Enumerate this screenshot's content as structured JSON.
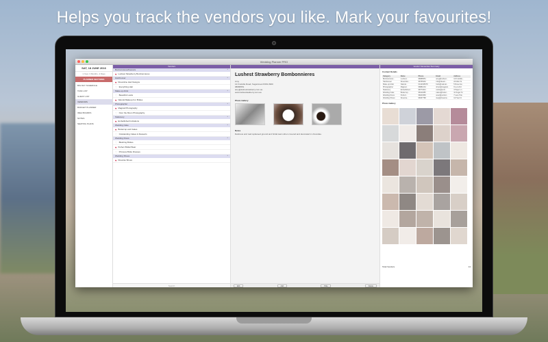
{
  "headline": "Helps you track the vendors you like. Mark your favourites!",
  "window": {
    "title": "Wedding Planner PRO"
  },
  "sidebar": {
    "date": "SAT, 18 JUNE 2016",
    "countdown": "1 Year, 3 Months, 4 Days",
    "section_label": "PLANNER SECTIONS",
    "items": [
      {
        "label": "BIG DAY SCHEDULE"
      },
      {
        "label": "TASK LIST"
      },
      {
        "label": "GUEST LIST"
      },
      {
        "label": "VENDORS"
      },
      {
        "label": "BUDGET PLANNER"
      },
      {
        "label": "IDEA BOARDS"
      },
      {
        "label": "NOTES"
      },
      {
        "label": "SEATING PLANS"
      }
    ]
  },
  "list_panel": {
    "title": "Vendors",
    "search_placeholder": "Search",
    "groups": [
      {
        "category": "Bonbonnieres/Favours",
        "vendors": [
          {
            "name": "Lushest Strawberry Bombonnieres",
            "fav": true
          }
        ]
      },
      {
        "category": "Hairdresser",
        "vendors": [
          {
            "name": "Dreamline Hair Designs",
            "fav": true
          },
          {
            "name": "Everything Hair",
            "fav": false
          }
        ]
      },
      {
        "category": "Make-up Artist",
        "vendors": [
          {
            "name": "Beautiful Looks",
            "fav": false
          },
          {
            "name": "Natural Makeup For Brides",
            "fav": true
          }
        ]
      },
      {
        "category": "Photographer",
        "vendors": [
          {
            "name": "Magical Photography",
            "fav": true
          },
          {
            "name": "Over the Moon Photography",
            "fav": false
          }
        ]
      },
      {
        "category": "Stationery",
        "vendors": [
          {
            "name": "Embellished Invitations",
            "fav": true
          }
        ]
      },
      {
        "category": "Wedding Cake",
        "vendors": [
          {
            "name": "Buttercup and Cakes",
            "fav": true
          },
          {
            "name": "Outstanding Cakes & Desserts",
            "fav": false
          }
        ]
      },
      {
        "category": "Wedding Dress",
        "vendors": [
          {
            "name": "Blushing Brides",
            "fav": false
          },
          {
            "name": "Perfect Bridal Wear",
            "fav": true
          },
          {
            "name": "Princess Bride Dresses",
            "fav": false
          }
        ]
      },
      {
        "category": "Wedding Shoes",
        "vendors": [
          {
            "name": "Dreamie Shoes",
            "fav": true
          }
        ]
      }
    ]
  },
  "detail": {
    "name": "Lushest Strawberry Bombonnieres",
    "address_lines": [
      "Amy",
      "14 Fruitville Road, Sugarcreek NSW 2900",
      "98686551",
      "amy@lushestrawberry.com.au",
      "www.lushestrawberry.com.au"
    ],
    "gallery_label": "Photo Gallery",
    "notes_label": "Notes",
    "notes": "Delicious and real replaceed ground and bridal team when covered and decorated in chocolate.",
    "buttons": [
      "Edit",
      "Add",
      "Hide",
      "Delete"
    ]
  },
  "summary": {
    "title": "Vendor Favourites Summary",
    "contact_label": "Contact Details",
    "columns": [
      "Category",
      "Name",
      "Phone",
      "Email",
      "Address"
    ],
    "rows": [
      [
        "Bonbonnieres...",
        "Lushest...",
        "98686551",
        "amy@lushest...",
        "14 Fruitville..."
      ],
      [
        "Hairdresser",
        "Dreamline...",
        "98765432",
        "info@dream...",
        "22 Main St"
      ],
      [
        "Make-up Artist",
        "Natural...",
        "0412345678",
        "hello@natural...",
        "5 Rose Ave"
      ],
      [
        "Photographer",
        "Magical...",
        "98881234",
        "shoot@magical...",
        "9 Lens Rd"
      ],
      [
        "Stationery",
        "Embellished...",
        "98773321",
        "cards@emb...",
        "3 Paper Ln"
      ],
      [
        "Wedding Cake",
        "Buttercup...",
        "98114455",
        "cakes@butter...",
        "41 Sugar St"
      ],
      [
        "Wedding Dress",
        "Perfect...",
        "98223366",
        "wear@perfect...",
        "7 Lace Pde"
      ],
      [
        "Wedding Shoes",
        "Dreamie...",
        "98337788",
        "step@dreamie...",
        "12 Heel Ct"
      ]
    ],
    "gallery_label": "Photo Gallery",
    "total_label": "Total Vendors",
    "total_value": "14",
    "tile_colors": [
      "#e8ddd4",
      "#cfd2d9",
      "#9c9aa6",
      "#e4d9d3",
      "#b58b9a",
      "#d7d9da",
      "#f0ebe8",
      "#8b7e7a",
      "#ddd2cb",
      "#c9a7b0",
      "#e6e2de",
      "#6f6b6e",
      "#d4c4b8",
      "#bfc3c6",
      "#eee8e2",
      "#a48e84",
      "#e2d6d0",
      "#d9d3cc",
      "#7c787b",
      "#c6b6ab",
      "#ebe5df",
      "#b9b2ad",
      "#d0c6bd",
      "#9a8f8b",
      "#f2eeea",
      "#cbb9ae",
      "#8f8884",
      "#e3dbd4",
      "#a9a3a0",
      "#d8cfc7",
      "#efe9e4",
      "#b3a69e",
      "#c0b3aa",
      "#e9e3dd",
      "#a7a09b",
      "#d5ccc4",
      "#f1ece8",
      "#bda99f",
      "#9c948f",
      "#e0d7cf",
      "#ffffff"
    ]
  }
}
